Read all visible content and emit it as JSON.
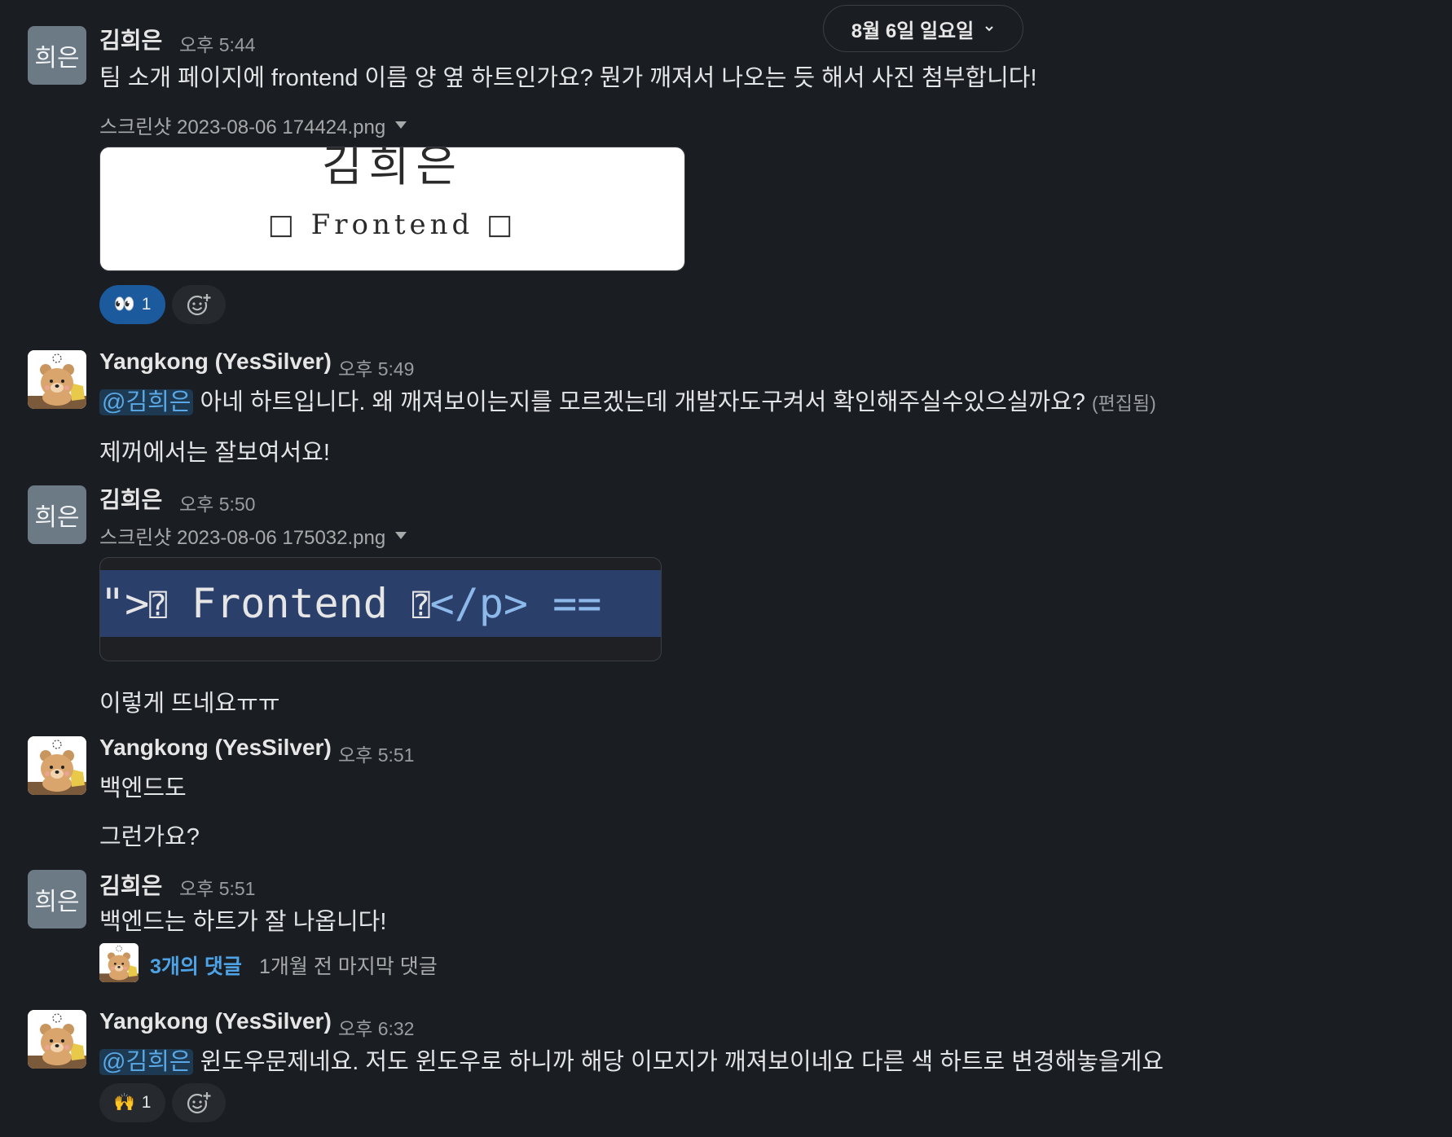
{
  "date_divider": {
    "label": "8월 6일 일요일"
  },
  "messages": [
    {
      "avatar_text": "희은",
      "author": "김희은",
      "time": "오후 5:44",
      "text": "팀 소개 페이지에 frontend 이름 양 옆 하트인가요? 뭔가 깨져서 나오는 듯 해서 사진 첨부합니다!",
      "file_name": "스크린샷 2023-08-06 174424.png",
      "image_text_line1": "김희은",
      "image_text_line2": "□ Frontend □",
      "reactions": [
        {
          "emoji": "👀",
          "count": "1"
        }
      ]
    },
    {
      "author": "Yangkong (YesSilver)",
      "time": "오후 5:49",
      "mention": "@김희은",
      "text": " 아네 하트입니다. 왜 깨져보이는지를 모르겠는데 개발자도구켜서 확인해주실수있으실까요?",
      "edited": "(편집됨)",
      "text2": "제꺼에서는 잘보여서요!"
    },
    {
      "avatar_text": "희은",
      "author": "김희은",
      "time": "오후 5:50",
      "file_name": "스크린샷 2023-08-06 175032.png",
      "code_prefix": "\">",
      "code_mid": " Frontend ",
      "code_suffix": "</p> ==",
      "text": "이렇게 뜨네요ㅠㅠ"
    },
    {
      "author": "Yangkong (YesSilver)",
      "time": "오후 5:51",
      "text": "백엔드도",
      "text2": "그런가요?"
    },
    {
      "avatar_text": "희은",
      "author": "김희은",
      "time": "오후 5:51",
      "text": "백엔드는 하트가 잘 나옵니다!",
      "thread_replies": "3개의 댓글",
      "thread_last": "1개월 전 마지막 댓글"
    },
    {
      "author": "Yangkong (YesSilver)",
      "time": "오후 6:32",
      "mention": "@김희은",
      "text": " 윈도우문제네요. 저도 윈도우로 하니까 해당 이모지가 깨져보이네요 다른 색 하트로 변경해놓을게요",
      "reactions": [
        {
          "emoji": "🙌",
          "count": "1"
        }
      ]
    }
  ]
}
